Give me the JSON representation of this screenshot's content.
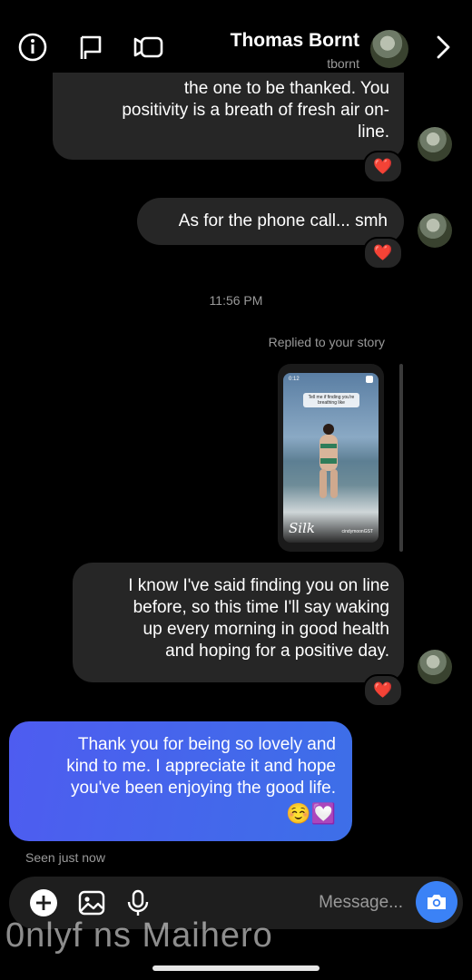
{
  "header": {
    "title": "Thomas Bornt",
    "subtitle": "tbornt",
    "icons": [
      "info-icon",
      "flag-icon",
      "video-icon",
      "chevron-right-icon"
    ]
  },
  "messages": {
    "m1": {
      "lines": [
        "the one to be thanked. You",
        "positivity is a breath of fresh air on-",
        "line."
      ],
      "reaction": "❤️"
    },
    "m2": {
      "text": "As for the phone call... smh",
      "reaction": "❤️"
    },
    "timestamp": "11:56 PM",
    "story_reply_label": "Replied to your story",
    "story": {
      "caption_top": "Tell me if finding you're breathing like",
      "story_time": "0:12",
      "brand_text": "Silk",
      "handle": "cindymoonGST"
    },
    "m3": {
      "lines": [
        "I know I've said finding you on line",
        "before, so this time I'll say waking",
        "up every morning in good health",
        "and hoping for a positive day."
      ],
      "reaction": "❤️"
    },
    "outgoing": {
      "lines": [
        "Thank you for being so lovely and",
        "kind to me. I appreciate it and hope",
        "you've been enjoying the good life."
      ],
      "emojis": "☺️💟"
    },
    "seen": "Seen just now"
  },
  "composer": {
    "placeholder": "Message..."
  },
  "watermark": "0nlyf ns Maihero"
}
